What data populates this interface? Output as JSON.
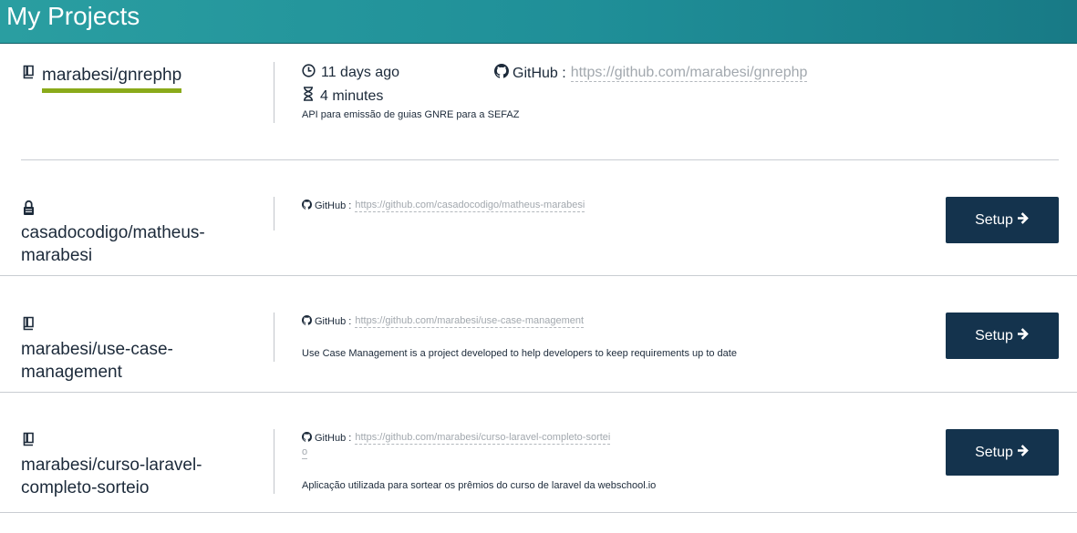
{
  "page": {
    "title": "My Projects"
  },
  "projects": [
    {
      "name": "marabesi/gnrephp",
      "icon": "book-icon",
      "last_run": "11 days ago",
      "duration": "4 minutes",
      "github_label": "GitHub :",
      "github_url": "https://github.com/marabesi/gnrephp",
      "description": "API para emissão de guias GNRE para a SEFAZ"
    },
    {
      "name_line1": "casadocodigo/matheus-",
      "name_line2": "marabesi",
      "icon": "lock-icon",
      "github_label": "GitHub :",
      "github_url": "https://github.com/casadocodigo/matheus-marabesi",
      "button": "Setup"
    },
    {
      "name_line1": "marabesi/use-case-",
      "name_line2": "management",
      "icon": "book-icon",
      "github_label": "GitHub :",
      "github_url": "https://github.com/marabesi/use-case-management",
      "description": "Use Case Management is a project developed to help developers to keep requirements up to date",
      "button": "Setup"
    },
    {
      "name_line1": "marabesi/curso-laravel-",
      "name_line2": "completo-sorteio",
      "icon": "book-icon",
      "github_label": "GitHub :",
      "github_url_line1": "https://github.com/marabesi/curso-laravel-completo-sortei",
      "github_url_line2": "o",
      "description": "Aplicação utilizada para sortear os prêmios do curso de laravel da webschool.io",
      "button": "Setup"
    }
  ],
  "colors": {
    "header_start": "#2a9ea1",
    "header_end": "#187a86",
    "button_bg": "#14334d",
    "active_underline": "#8aaa1a",
    "link": "#a2a8ae"
  }
}
